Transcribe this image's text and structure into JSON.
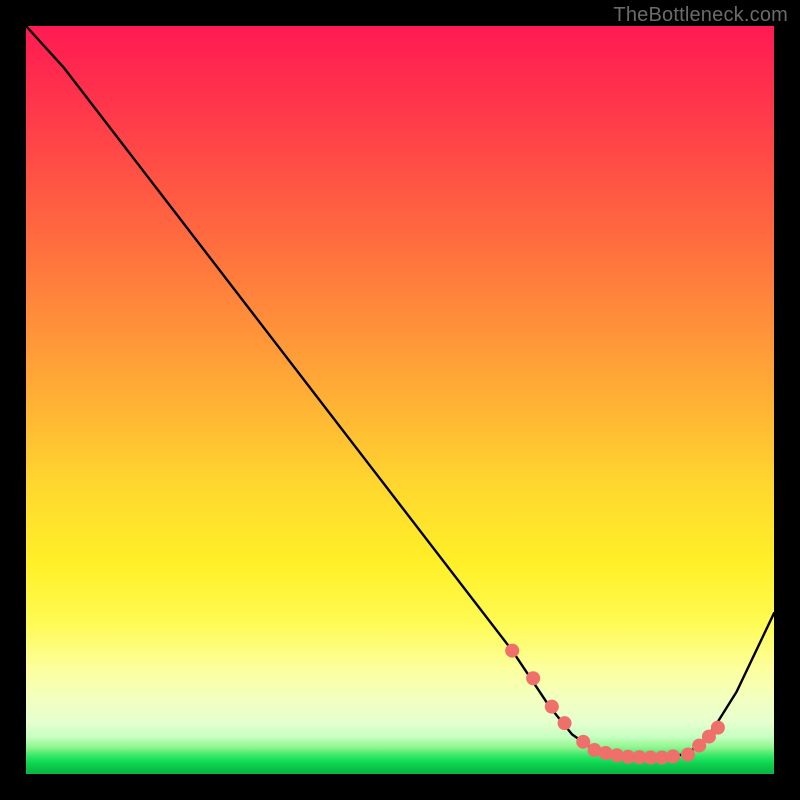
{
  "watermark": "TheBottleneck.com",
  "chart_data": {
    "type": "line",
    "title": "",
    "xlabel": "",
    "ylabel": "",
    "xlim": [
      0,
      100
    ],
    "ylim": [
      0,
      100
    ],
    "grid": false,
    "legend": false,
    "series": [
      {
        "name": "bottleneck-curve",
        "color": "#000000",
        "x": [
          0,
          5,
          10,
          20,
          30,
          40,
          50,
          60,
          65,
          70,
          73,
          76,
          80,
          84,
          88,
          90,
          92,
          95,
          100
        ],
        "y": [
          100,
          94.5,
          88,
          75,
          62,
          49,
          36,
          23,
          16.5,
          9,
          5.3,
          3.2,
          2.3,
          2.2,
          2.6,
          3.8,
          6.2,
          11,
          21.5
        ]
      }
    ],
    "markers": {
      "name": "highlight-dots",
      "color": "#ef6f6a",
      "radius_px": 7,
      "x": [
        65.0,
        67.8,
        70.3,
        72.0,
        74.5,
        76.0,
        77.5,
        79.0,
        80.5,
        82.0,
        83.5,
        85.0,
        86.5,
        88.5,
        90.0,
        91.3,
        92.5
      ],
      "y": [
        16.5,
        12.8,
        9.0,
        6.8,
        4.3,
        3.2,
        2.8,
        2.5,
        2.3,
        2.25,
        2.2,
        2.2,
        2.35,
        2.6,
        3.8,
        5.0,
        6.2
      ]
    },
    "background_gradient": {
      "stops": [
        {
          "pos": 0.0,
          "color": "#ff1a53"
        },
        {
          "pos": 0.4,
          "color": "#ff903a"
        },
        {
          "pos": 0.72,
          "color": "#fff028"
        },
        {
          "pos": 0.93,
          "color": "#e6ffcf"
        },
        {
          "pos": 1.0,
          "color": "#09b444"
        }
      ]
    }
  }
}
